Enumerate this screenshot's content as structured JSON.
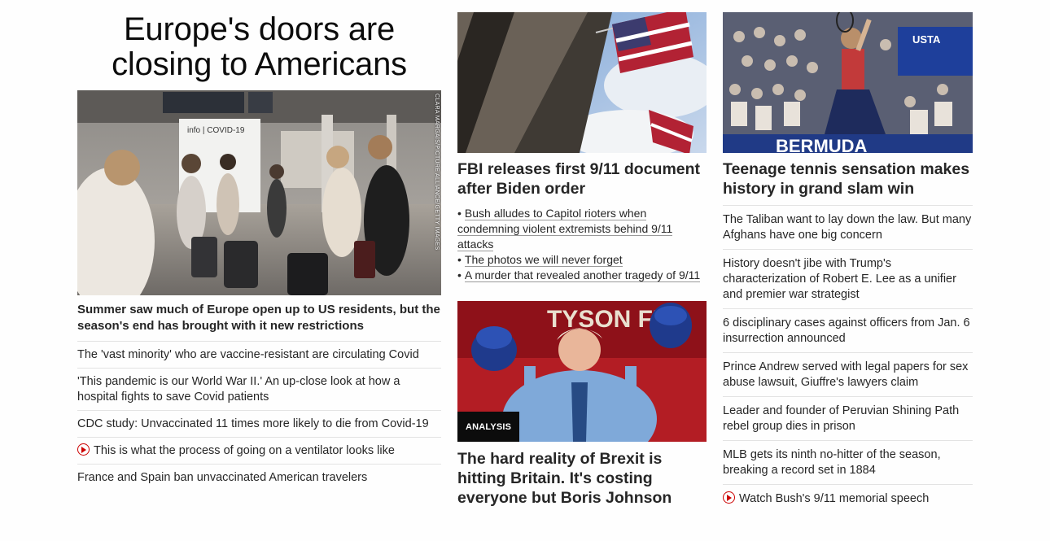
{
  "left": {
    "title": "Europe's doors are closing to Americans",
    "image_alt": "Travelers with luggage at an airport terminal",
    "credit": "CLARA MARGAIS/PICTURE ALLIANCE/GETTY IMAGES",
    "sign_text": "info | COVID-19",
    "headline": "Summer saw much of Europe open up to US residents, but the season's end has brought with it new restrictions",
    "links": [
      {
        "text": "The 'vast minority' who are vaccine-resistant are circulating Covid",
        "video": false
      },
      {
        "text": "'This pandemic is our World War II.' An up-close look at how a hospital fights to save Covid patients",
        "video": false
      },
      {
        "text": "CDC study: Unvaccinated 11 times more likely to die from Covid-19",
        "video": false
      },
      {
        "text": "This is what the process of going on a ventilator looks like",
        "video": true
      },
      {
        "text": "France and Spain ban unvaccinated American travelers",
        "video": false
      }
    ]
  },
  "middle": {
    "story1": {
      "headline": "FBI releases first 9/11 document after Biden order",
      "bullets": [
        "Bush alludes to Capitol rioters when condemning violent extremists behind 9/11 attacks",
        "The photos we will never forget",
        "A murder that revealed another tragedy of 9/11"
      ]
    },
    "story2": {
      "badge": "ANALYSIS",
      "backdrop_text": "TYSON FU",
      "headline": "The hard reality of Brexit is hitting Britain. It's costing everyone but Boris Johnson"
    }
  },
  "right": {
    "banner_text": "USTA",
    "board_text": "BERMUDA",
    "headline": "Teenage tennis sensation makes history in grand slam win",
    "links": [
      {
        "text": "The Taliban want to lay down the law. But many Afghans have one big concern",
        "video": false
      },
      {
        "text": "History doesn't jibe with Trump's characterization of Robert E. Lee as a unifier and premier war strategist",
        "video": false
      },
      {
        "text": "6 disciplinary cases against officers from Jan. 6 insurrection announced",
        "video": false
      },
      {
        "text": "Prince Andrew served with legal papers for sex abuse lawsuit, Giuffre's lawyers claim",
        "video": false
      },
      {
        "text": "Leader and founder of Peruvian Shining Path rebel group dies in prison",
        "video": false
      },
      {
        "text": "MLB gets its ninth no-hitter of the season, breaking a record set in 1884",
        "video": false
      },
      {
        "text": "Watch Bush's 9/11 memorial speech",
        "video": true
      }
    ]
  },
  "colors": {
    "accent": "#cc0000",
    "text": "#262626",
    "divider": "#e3e3e3"
  }
}
